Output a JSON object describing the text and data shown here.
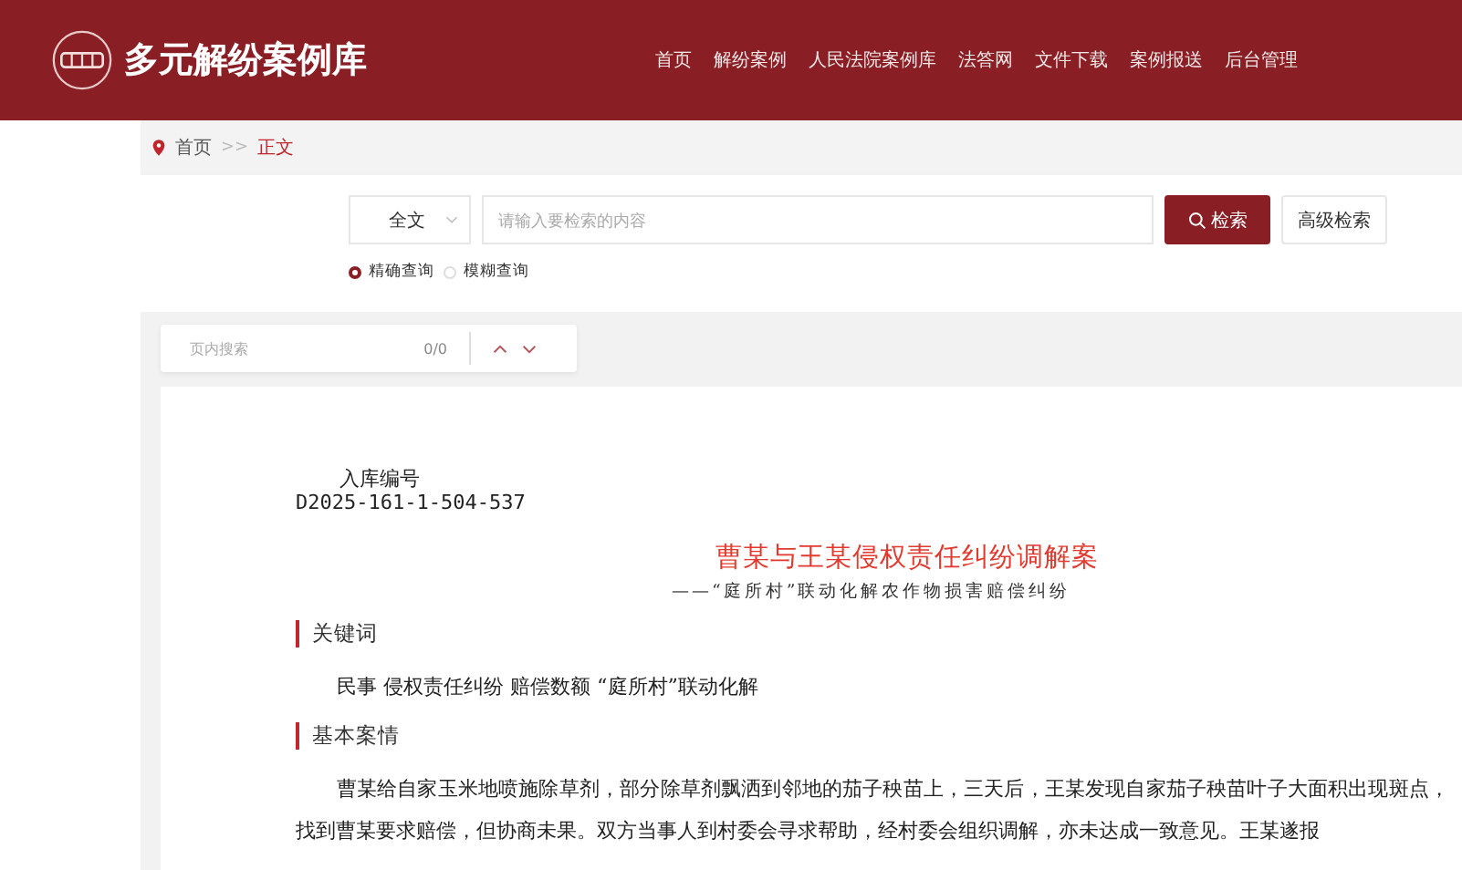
{
  "header": {
    "title": "多元解纷案例库",
    "nav": [
      {
        "label": "首页"
      },
      {
        "label": "解纷案例"
      },
      {
        "label": "人民法院案例库"
      },
      {
        "label": "法答网"
      },
      {
        "label": "文件下载"
      },
      {
        "label": "案例报送"
      },
      {
        "label": "后台管理"
      }
    ]
  },
  "breadcrumb": {
    "separator": ">>",
    "items": [
      {
        "label": "首页",
        "current": false
      },
      {
        "label": "正文",
        "current": true
      }
    ]
  },
  "search": {
    "scope": "全文",
    "placeholder": "请输入要检索的内容",
    "button": "检索",
    "advanced": "高级检索",
    "modes": [
      {
        "label": "精确查询",
        "selected": true
      },
      {
        "label": "模糊查询",
        "selected": false
      }
    ]
  },
  "page_search": {
    "placeholder": "页内搜索",
    "count": "0/0"
  },
  "document": {
    "id_label": "入库编号",
    "id": "D2025-161-1-504-537",
    "title": "曹某与王某侵权责任纠纷调解案",
    "subtitle": "——“庭所村”联动化解农作物损害赔偿纠纷",
    "sections": [
      {
        "heading": "关键词",
        "paragraph": "民事 侵权责任纠纷 赔偿数额 “庭所村”联动化解"
      },
      {
        "heading": "基本案情",
        "paragraph": "曹某给自家玉米地喷施除草剂，部分除草剂飘洒到邻地的茄子秧苗上，三天后，王某发现自家茄子秧苗叶子大面积出现斑点，找到曹某要求赔偿，但协商未果。双方当事人到村委会寻求帮助，经村委会组织调解，亦未达成一致意见。王某遂报"
      }
    ]
  }
}
